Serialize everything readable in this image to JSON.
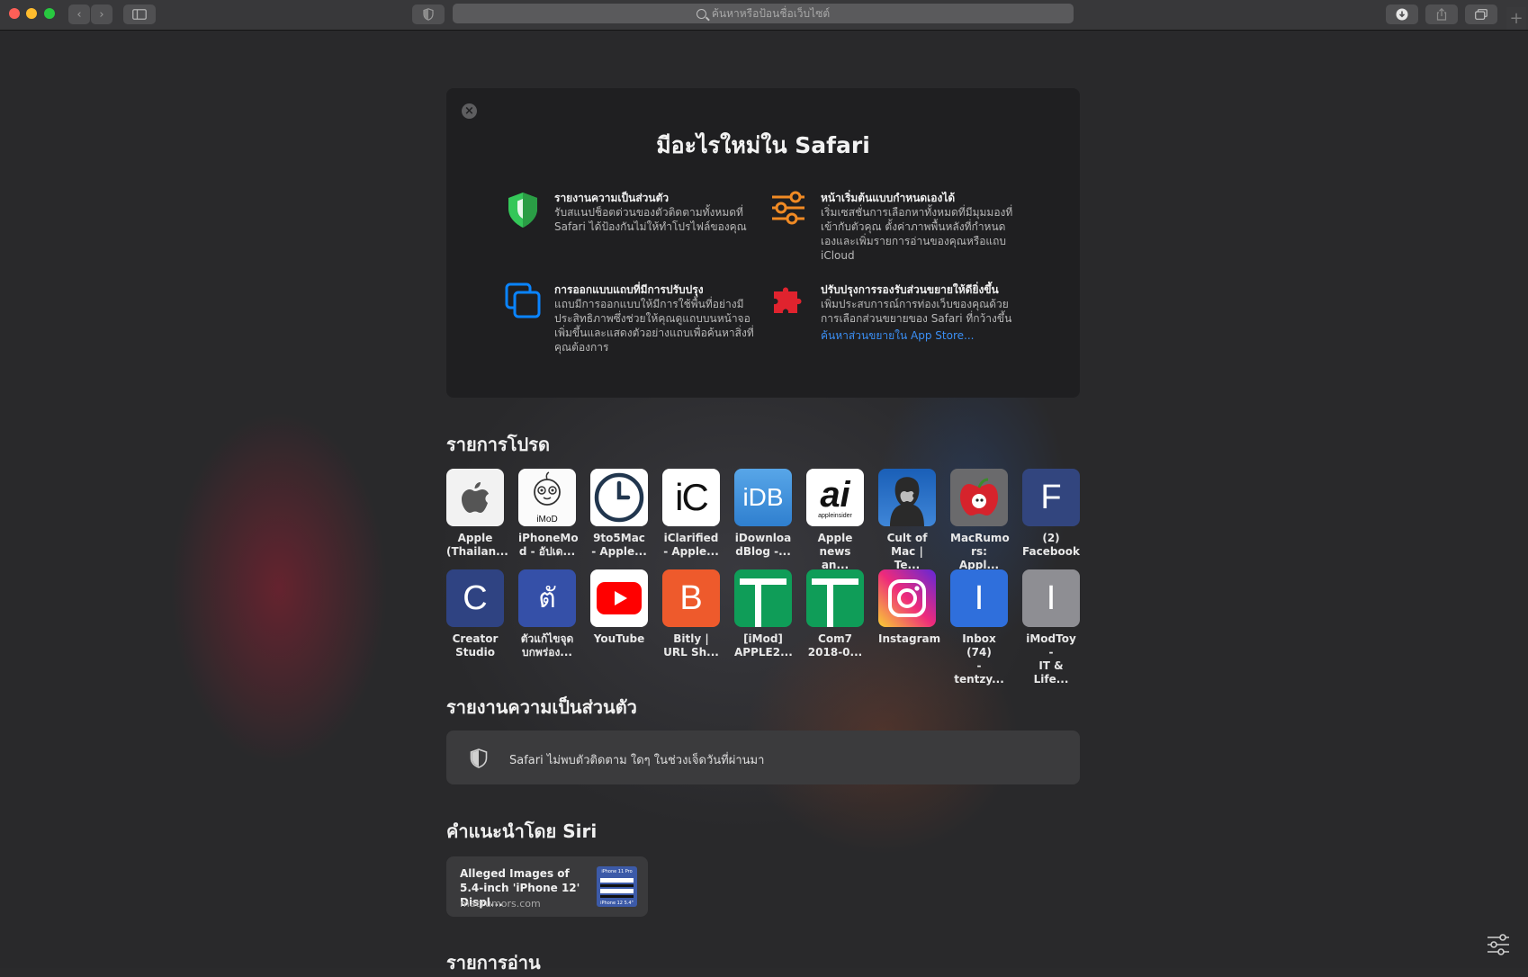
{
  "toolbar": {
    "address_placeholder": "ค้นหาหรือป้อนชื่อเว็บไซต์",
    "icons": [
      "back-icon",
      "forward-icon",
      "sidebar-icon",
      "privacy-shield-icon",
      "download-icon",
      "share-icon",
      "tabs-overview-icon",
      "new-tab-icon"
    ]
  },
  "whats_new": {
    "title": "มีอะไรใหม่ใน Safari",
    "features": [
      {
        "icon": "shield-icon",
        "heading": "รายงานความเป็นส่วนตัว",
        "body": "รับสแนปช็อตด่วนของตัวติดตามทั้งหมดที่ Safari ได้ป้องกันไม่ให้ทำโปรไฟล์ของคุณ",
        "link": ""
      },
      {
        "icon": "sliders-icon",
        "heading": "หน้าเริ่มต้นแบบกำหนดเองได้",
        "body": "เริ่มเซสชั่นการเลือกหาทั้งหมดที่มีมุมมองที่เข้ากับตัวคุณ ตั้งค่าภาพพื้นหลังที่กำหนดเองและเพิ่มรายการอ่านของคุณหรือแถบ iCloud",
        "link": ""
      },
      {
        "icon": "tabs-icon",
        "heading": "การออกแบบแถบที่มีการปรับปรุง",
        "body": "แถบมีการออกแบบให้มีการใช้พื้นที่อย่างมีประสิทธิภาพซึ่งช่วยให้คุณดูแถบบนหน้าจอเพิ่มขึ้นและแสดงตัวอย่างแถบเพื่อค้นหาสิ่งที่คุณต้องการ",
        "link": ""
      },
      {
        "icon": "puzzle-icon",
        "heading": "ปรับปรุงการรองรับส่วนขยายให้ดียิ่งขึ้น",
        "body": "เพิ่มประสบการณ์การท่องเว็บของคุณด้วยการเลือกส่วนขยายของ Safari ที่กว้างขึ้น",
        "link": "ค้นหาส่วนขยายใน App Store..."
      }
    ]
  },
  "favorites": {
    "title": "รายการโปรด",
    "items": [
      {
        "label": "Apple\n(Thailan...",
        "icon": "apple-logo-icon",
        "tile": "apple"
      },
      {
        "label": "iPhoneMo\nd - อัปเด...",
        "icon": "imod-logo-icon",
        "tile": "imod"
      },
      {
        "label": "9to5Mac\n- Apple...",
        "icon": "clock-icon",
        "tile": "clock"
      },
      {
        "label": "iClarified\n- Apple...",
        "icon": "iclarified-logo-icon",
        "tile": "ic",
        "text": "iC"
      },
      {
        "label": "iDownloa\ndBlog -...",
        "icon": "idb-logo-icon",
        "tile": "idb",
        "text": "iDB"
      },
      {
        "label": "Apple\nnews an...",
        "icon": "appleinsider-logo-icon",
        "tile": "ai",
        "text": "ai",
        "sub": "appleinsider"
      },
      {
        "label": "Cult of\nMac | Te...",
        "icon": "cultofmac-logo-icon",
        "tile": "com"
      },
      {
        "label": "MacRumo\nrs: Appl...",
        "icon": "macrumors-logo-icon",
        "tile": "mr"
      },
      {
        "label": "(2)\nFacebook",
        "icon": "letter-f-icon",
        "tile": "letter",
        "text": "F",
        "color": "#32457e"
      },
      {
        "label": "Creator\nStudio",
        "icon": "letter-c-icon",
        "tile": "letter",
        "text": "C",
        "color": "#2f4382"
      },
      {
        "label": "ตัวแก้ไขจุด\nบกพร่อง...",
        "icon": "letter-thai-icon",
        "tile": "letter",
        "text": "ตั",
        "color": "#3550a8"
      },
      {
        "label": "YouTube",
        "icon": "youtube-logo-icon",
        "tile": "yt"
      },
      {
        "label": "Bitly |\nURL Sh...",
        "icon": "letter-b-icon",
        "tile": "letter",
        "text": "B",
        "color": "#ee5a2c"
      },
      {
        "label": "[iMod]\nAPPLE2...",
        "icon": "sheets-icon",
        "tile": "sheet"
      },
      {
        "label": "Com7\n2018-0...",
        "icon": "sheets-icon",
        "tile": "sheet"
      },
      {
        "label": "Instagram",
        "icon": "instagram-logo-icon",
        "tile": "ig"
      },
      {
        "label": "Inbox (74)\n- tentzy...",
        "icon": "letter-i-icon",
        "tile": "letter",
        "text": "I",
        "color": "#2f6fdc"
      },
      {
        "label": "iModToy -\nIT & Life...",
        "icon": "letter-i-icon",
        "tile": "letter",
        "text": "I",
        "color": "#8e8e93"
      }
    ]
  },
  "privacy_report": {
    "title": "รายงานความเป็นส่วนตัว",
    "text": "Safari ไม่พบตัวติดตาม ใดๆ ในช่วงเจ็ดวันที่ผ่านมา"
  },
  "siri": {
    "title": "คำแนะนำโดย Siri",
    "card_title": "Alleged Images of 5.4-inch 'iPhone 12' Displ...",
    "card_url": "macrumors.com",
    "thumb_top": "iPhone 11 Pro",
    "thumb_bottom": "iPhone 12 5.4\""
  },
  "reading_list": {
    "title": "รายการอ่าน"
  },
  "colors": {
    "accent_link": "#3b8ff5",
    "shield_green": "#34c759",
    "sliders_orange": "#f08a24",
    "tabs_blue": "#0a84ff",
    "puzzle_red": "#e0232e"
  }
}
